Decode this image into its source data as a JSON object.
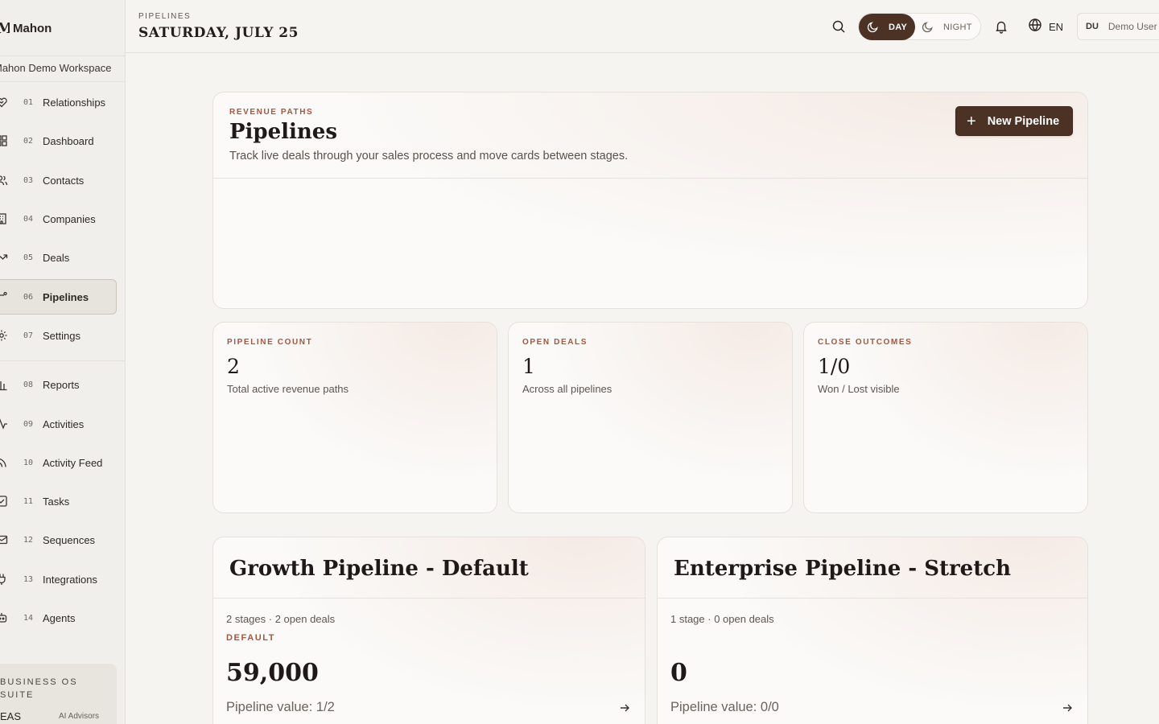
{
  "sidebar": {
    "brand_mark": "M",
    "brand_name": "Mahon",
    "workspace": "Mahon Demo Workspace",
    "items": [
      {
        "num": "01",
        "label": "Relationships",
        "icon": "heart-handshake-icon"
      },
      {
        "num": "02",
        "label": "Dashboard",
        "icon": "grid-icon"
      },
      {
        "num": "03",
        "label": "Contacts",
        "icon": "users-icon"
      },
      {
        "num": "04",
        "label": "Companies",
        "icon": "building-icon"
      },
      {
        "num": "05",
        "label": "Deals",
        "icon": "trend-up-icon"
      },
      {
        "num": "06",
        "label": "Pipelines",
        "icon": "route-icon",
        "active": true
      },
      {
        "num": "07",
        "label": "Settings",
        "icon": "gear-icon"
      },
      {
        "num": "08",
        "label": "Reports",
        "icon": "bar-chart-icon"
      },
      {
        "num": "09",
        "label": "Activities",
        "icon": "activity-icon"
      },
      {
        "num": "10",
        "label": "Activity Feed",
        "icon": "rss-icon"
      },
      {
        "num": "11",
        "label": "Tasks",
        "icon": "check-square-icon"
      },
      {
        "num": "12",
        "label": "Sequences",
        "icon": "mail-icon"
      },
      {
        "num": "13",
        "label": "Integrations",
        "icon": "plug-icon"
      },
      {
        "num": "14",
        "label": "Agents",
        "icon": "bot-icon"
      }
    ],
    "suite": {
      "title": "BUSINESS OS SUITE",
      "left": "EAS",
      "right": "AI Advisors"
    }
  },
  "topbar": {
    "breadcrumb": "PIPELINES",
    "date": "SATURDAY, JULY 25",
    "day_label": "DAY",
    "night_label": "NIGHT",
    "language": "EN",
    "user_initials": "DU",
    "user_name": "Demo User"
  },
  "hero": {
    "kicker": "REVENUE PATHS",
    "title": "Pipelines",
    "subtitle": "Track live deals through your sales process and move cards between stages.",
    "new_button": "New Pipeline"
  },
  "stats": [
    {
      "kicker": "PIPELINE COUNT",
      "value": "2",
      "desc": "Total active revenue paths"
    },
    {
      "kicker": "OPEN DEALS",
      "value": "1",
      "desc": "Across all pipelines"
    },
    {
      "kicker": "CLOSE OUTCOMES",
      "value": "1/0",
      "desc": "Won / Lost visible"
    }
  ],
  "pipelines": [
    {
      "title": "Growth Pipeline - Default",
      "meta": "2 stages · 2 open deals",
      "badge": "DEFAULT",
      "value": "59,000",
      "pipeline_value": "Pipeline value: 1/2"
    },
    {
      "title": "Enterprise Pipeline - Stretch",
      "meta": "1 stage · 0 open deals",
      "badge": "",
      "value": "0",
      "pipeline_value": "Pipeline value: 0/0"
    }
  ],
  "colors": {
    "accent": "#4b3224",
    "kicker": "#a4573f",
    "background": "#f6f4f1"
  }
}
